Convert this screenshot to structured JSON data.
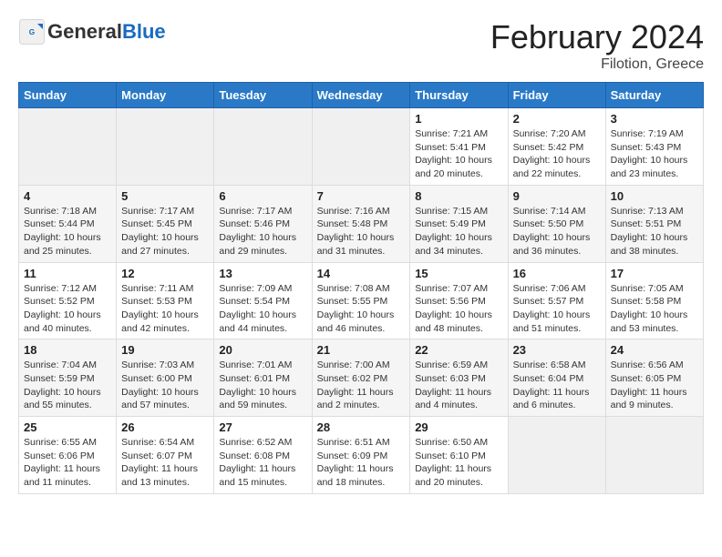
{
  "header": {
    "logo_general": "General",
    "logo_blue": "Blue",
    "month_title": "February 2024",
    "location": "Filotion, Greece"
  },
  "weekdays": [
    "Sunday",
    "Monday",
    "Tuesday",
    "Wednesday",
    "Thursday",
    "Friday",
    "Saturday"
  ],
  "weeks": [
    [
      {
        "day": "",
        "info": ""
      },
      {
        "day": "",
        "info": ""
      },
      {
        "day": "",
        "info": ""
      },
      {
        "day": "",
        "info": ""
      },
      {
        "day": "1",
        "info": "Sunrise: 7:21 AM\nSunset: 5:41 PM\nDaylight: 10 hours\nand 20 minutes."
      },
      {
        "day": "2",
        "info": "Sunrise: 7:20 AM\nSunset: 5:42 PM\nDaylight: 10 hours\nand 22 minutes."
      },
      {
        "day": "3",
        "info": "Sunrise: 7:19 AM\nSunset: 5:43 PM\nDaylight: 10 hours\nand 23 minutes."
      }
    ],
    [
      {
        "day": "4",
        "info": "Sunrise: 7:18 AM\nSunset: 5:44 PM\nDaylight: 10 hours\nand 25 minutes."
      },
      {
        "day": "5",
        "info": "Sunrise: 7:17 AM\nSunset: 5:45 PM\nDaylight: 10 hours\nand 27 minutes."
      },
      {
        "day": "6",
        "info": "Sunrise: 7:17 AM\nSunset: 5:46 PM\nDaylight: 10 hours\nand 29 minutes."
      },
      {
        "day": "7",
        "info": "Sunrise: 7:16 AM\nSunset: 5:48 PM\nDaylight: 10 hours\nand 31 minutes."
      },
      {
        "day": "8",
        "info": "Sunrise: 7:15 AM\nSunset: 5:49 PM\nDaylight: 10 hours\nand 34 minutes."
      },
      {
        "day": "9",
        "info": "Sunrise: 7:14 AM\nSunset: 5:50 PM\nDaylight: 10 hours\nand 36 minutes."
      },
      {
        "day": "10",
        "info": "Sunrise: 7:13 AM\nSunset: 5:51 PM\nDaylight: 10 hours\nand 38 minutes."
      }
    ],
    [
      {
        "day": "11",
        "info": "Sunrise: 7:12 AM\nSunset: 5:52 PM\nDaylight: 10 hours\nand 40 minutes."
      },
      {
        "day": "12",
        "info": "Sunrise: 7:11 AM\nSunset: 5:53 PM\nDaylight: 10 hours\nand 42 minutes."
      },
      {
        "day": "13",
        "info": "Sunrise: 7:09 AM\nSunset: 5:54 PM\nDaylight: 10 hours\nand 44 minutes."
      },
      {
        "day": "14",
        "info": "Sunrise: 7:08 AM\nSunset: 5:55 PM\nDaylight: 10 hours\nand 46 minutes."
      },
      {
        "day": "15",
        "info": "Sunrise: 7:07 AM\nSunset: 5:56 PM\nDaylight: 10 hours\nand 48 minutes."
      },
      {
        "day": "16",
        "info": "Sunrise: 7:06 AM\nSunset: 5:57 PM\nDaylight: 10 hours\nand 51 minutes."
      },
      {
        "day": "17",
        "info": "Sunrise: 7:05 AM\nSunset: 5:58 PM\nDaylight: 10 hours\nand 53 minutes."
      }
    ],
    [
      {
        "day": "18",
        "info": "Sunrise: 7:04 AM\nSunset: 5:59 PM\nDaylight: 10 hours\nand 55 minutes."
      },
      {
        "day": "19",
        "info": "Sunrise: 7:03 AM\nSunset: 6:00 PM\nDaylight: 10 hours\nand 57 minutes."
      },
      {
        "day": "20",
        "info": "Sunrise: 7:01 AM\nSunset: 6:01 PM\nDaylight: 10 hours\nand 59 minutes."
      },
      {
        "day": "21",
        "info": "Sunrise: 7:00 AM\nSunset: 6:02 PM\nDaylight: 11 hours\nand 2 minutes."
      },
      {
        "day": "22",
        "info": "Sunrise: 6:59 AM\nSunset: 6:03 PM\nDaylight: 11 hours\nand 4 minutes."
      },
      {
        "day": "23",
        "info": "Sunrise: 6:58 AM\nSunset: 6:04 PM\nDaylight: 11 hours\nand 6 minutes."
      },
      {
        "day": "24",
        "info": "Sunrise: 6:56 AM\nSunset: 6:05 PM\nDaylight: 11 hours\nand 9 minutes."
      }
    ],
    [
      {
        "day": "25",
        "info": "Sunrise: 6:55 AM\nSunset: 6:06 PM\nDaylight: 11 hours\nand 11 minutes."
      },
      {
        "day": "26",
        "info": "Sunrise: 6:54 AM\nSunset: 6:07 PM\nDaylight: 11 hours\nand 13 minutes."
      },
      {
        "day": "27",
        "info": "Sunrise: 6:52 AM\nSunset: 6:08 PM\nDaylight: 11 hours\nand 15 minutes."
      },
      {
        "day": "28",
        "info": "Sunrise: 6:51 AM\nSunset: 6:09 PM\nDaylight: 11 hours\nand 18 minutes."
      },
      {
        "day": "29",
        "info": "Sunrise: 6:50 AM\nSunset: 6:10 PM\nDaylight: 11 hours\nand 20 minutes."
      },
      {
        "day": "",
        "info": ""
      },
      {
        "day": "",
        "info": ""
      }
    ]
  ]
}
